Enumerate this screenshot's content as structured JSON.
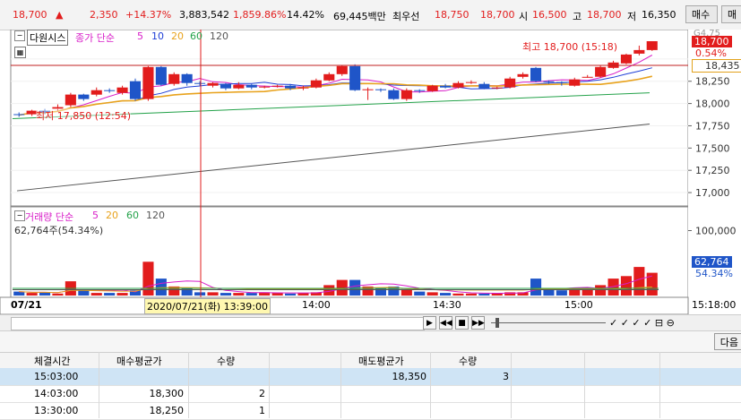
{
  "quote_bar": {
    "price": "18,700",
    "change": "2,350",
    "change_pct": "+14.37%",
    "volume": "3,883,542",
    "volume_ratio": "1,859.86%",
    "turnover": "14.42%",
    "amount": "69,445백만",
    "best_bid_label": "최우선",
    "best_bid": "18,750",
    "best_ask": "18,700",
    "open_label": "시",
    "open": "16,500",
    "high_label": "고",
    "high": "18,700",
    "low_label": "저",
    "low": "16,350",
    "buy_button": "매수",
    "sell_button": "매"
  },
  "price_panel": {
    "indicator_toggle": "다원시스",
    "legend_title": "종가 단순",
    "ma_periods": [
      "5",
      "10",
      "20",
      "60",
      "120"
    ],
    "ma_colors": [
      "#d81ec8",
      "#1f3fd6",
      "#e8a21c",
      "#24a24a",
      "#555555"
    ],
    "high_annotation": "최고 18,700 (15:18)",
    "low_annotation": "최저 17,850 (12:54)",
    "current_price_tag": "18,700",
    "current_pct_tag": "0.54%",
    "ref_price_tag": "18,435",
    "top_clip_tag": "G4.75"
  },
  "volume_panel": {
    "legend_title": "거래량 단순",
    "ma_periods": [
      "5",
      "20",
      "60",
      "120"
    ],
    "summary": "62,764주(54.34%)",
    "current_tag": "62,764",
    "current_pct": "54.34%"
  },
  "x_axis": {
    "date_label": "07/21",
    "cursor_label": "2020/07/21(화) 13:39:00",
    "time_ticks": [
      "14:00",
      "14:30",
      "15:00",
      "15:18:00"
    ]
  },
  "table": {
    "headers": [
      "체결시간",
      "매수평균가",
      "수량",
      "매도평균가",
      "수량"
    ],
    "rows": [
      {
        "time": "15:03:00",
        "buy_avg": "",
        "buy_qty": "",
        "sell_avg": "18,350",
        "sell_qty": "3"
      },
      {
        "time": "14:03:00",
        "buy_avg": "18,300",
        "buy_qty": "2",
        "sell_avg": "",
        "sell_qty": ""
      },
      {
        "time": "13:30:00",
        "buy_avg": "18,250",
        "buy_qty": "1",
        "sell_avg": "",
        "sell_qty": ""
      }
    ],
    "side_button": "다음"
  },
  "chart_data": {
    "type": "candlestick",
    "x_label_start": "07/21",
    "ylim": [
      16900,
      18750
    ],
    "y_ticks": [
      17000,
      17250,
      17500,
      17750,
      18000,
      18250,
      18500
    ],
    "candles": [
      {
        "o": 17880,
        "c": 17870,
        "h": 17900,
        "l": 17850
      },
      {
        "o": 17880,
        "c": 17920,
        "h": 17930,
        "l": 17860
      },
      {
        "o": 17920,
        "c": 17900,
        "h": 17940,
        "l": 17880
      },
      {
        "o": 17940,
        "c": 17960,
        "h": 17990,
        "l": 17920
      },
      {
        "o": 17980,
        "c": 18100,
        "h": 18120,
        "l": 17960
      },
      {
        "o": 18100,
        "c": 18050,
        "h": 18110,
        "l": 18030
      },
      {
        "o": 18100,
        "c": 18150,
        "h": 18180,
        "l": 18080
      },
      {
        "o": 18150,
        "c": 18140,
        "h": 18170,
        "l": 18120
      },
      {
        "o": 18120,
        "c": 18180,
        "h": 18200,
        "l": 18100
      },
      {
        "o": 18250,
        "c": 18050,
        "h": 18280,
        "l": 18030
      },
      {
        "o": 18050,
        "c": 18410,
        "h": 18420,
        "l": 18030
      },
      {
        "o": 18410,
        "c": 18210,
        "h": 18420,
        "l": 18200
      },
      {
        "o": 18220,
        "c": 18330,
        "h": 18350,
        "l": 18200
      },
      {
        "o": 18330,
        "c": 18230,
        "h": 18340,
        "l": 18200
      },
      {
        "o": 18230,
        "c": 18220,
        "h": 18250,
        "l": 18200
      },
      {
        "o": 18200,
        "c": 18230,
        "h": 18240,
        "l": 18180
      },
      {
        "o": 18220,
        "c": 18170,
        "h": 18230,
        "l": 18150
      },
      {
        "o": 18170,
        "c": 18210,
        "h": 18240,
        "l": 18160
      },
      {
        "o": 18210,
        "c": 18180,
        "h": 18220,
        "l": 18160
      },
      {
        "o": 18180,
        "c": 18190,
        "h": 18200,
        "l": 18170
      },
      {
        "o": 18190,
        "c": 18200,
        "h": 18210,
        "l": 18180
      },
      {
        "o": 18200,
        "c": 18170,
        "h": 18220,
        "l": 18150
      },
      {
        "o": 18170,
        "c": 18180,
        "h": 18200,
        "l": 18150
      },
      {
        "o": 18180,
        "c": 18260,
        "h": 18280,
        "l": 18170
      },
      {
        "o": 18260,
        "c": 18330,
        "h": 18350,
        "l": 18250
      },
      {
        "o": 18330,
        "c": 18420,
        "h": 18430,
        "l": 18310
      },
      {
        "o": 18420,
        "c": 18150,
        "h": 18440,
        "l": 18140
      },
      {
        "o": 18150,
        "c": 18160,
        "h": 18180,
        "l": 18040
      },
      {
        "o": 18160,
        "c": 18150,
        "h": 18170,
        "l": 18130
      },
      {
        "o": 18150,
        "c": 18050,
        "h": 18170,
        "l": 18040
      },
      {
        "o": 18050,
        "c": 18150,
        "h": 18170,
        "l": 18030
      },
      {
        "o": 18150,
        "c": 18140,
        "h": 18160,
        "l": 18120
      },
      {
        "o": 18140,
        "c": 18200,
        "h": 18210,
        "l": 18130
      },
      {
        "o": 18200,
        "c": 18180,
        "h": 18220,
        "l": 18170
      },
      {
        "o": 18180,
        "c": 18230,
        "h": 18250,
        "l": 18170
      },
      {
        "o": 18230,
        "c": 18240,
        "h": 18260,
        "l": 18220
      },
      {
        "o": 18220,
        "c": 18170,
        "h": 18240,
        "l": 18160
      },
      {
        "o": 18170,
        "c": 18180,
        "h": 18190,
        "l": 18160
      },
      {
        "o": 18180,
        "c": 18280,
        "h": 18300,
        "l": 18170
      },
      {
        "o": 18300,
        "c": 18330,
        "h": 18350,
        "l": 18280
      },
      {
        "o": 18400,
        "c": 18250,
        "h": 18410,
        "l": 18240
      },
      {
        "o": 18250,
        "c": 18240,
        "h": 18260,
        "l": 18220
      },
      {
        "o": 18240,
        "c": 18230,
        "h": 18250,
        "l": 18200
      },
      {
        "o": 18200,
        "c": 18270,
        "h": 18290,
        "l": 18190
      },
      {
        "o": 18300,
        "c": 18300,
        "h": 18320,
        "l": 18290
      },
      {
        "o": 18300,
        "c": 18410,
        "h": 18430,
        "l": 18290
      },
      {
        "o": 18400,
        "c": 18460,
        "h": 18480,
        "l": 18390
      },
      {
        "o": 18450,
        "c": 18550,
        "h": 18560,
        "l": 18440
      },
      {
        "o": 18560,
        "c": 18600,
        "h": 18650,
        "l": 18540
      },
      {
        "o": 18600,
        "c": 18700,
        "h": 18700,
        "l": 18590
      }
    ],
    "volumes": [
      6,
      4,
      5,
      3,
      22,
      8,
      4,
      4,
      4,
      8,
      52,
      26,
      14,
      12,
      5,
      5,
      4,
      4,
      4,
      5,
      4,
      3,
      4,
      5,
      16,
      24,
      24,
      14,
      12,
      14,
      10,
      6,
      5,
      4,
      3,
      3,
      3,
      4,
      5,
      5,
      26,
      10,
      8,
      10,
      9,
      16,
      26,
      30,
      44,
      35
    ],
    "volume_ylim": [
      0,
      120
    ]
  }
}
